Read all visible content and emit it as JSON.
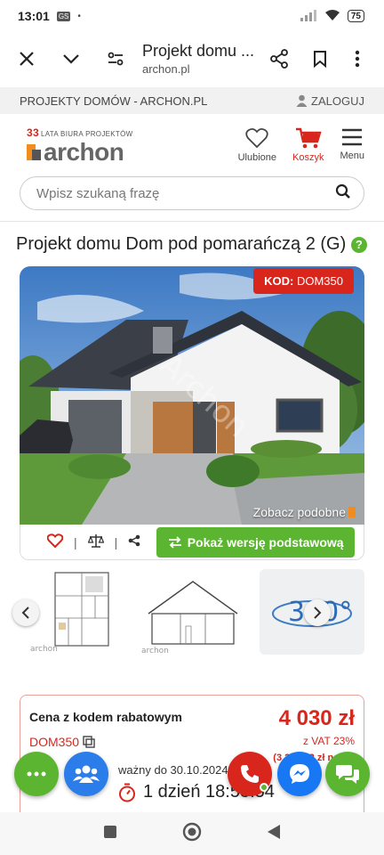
{
  "status_bar": {
    "time": "13:01",
    "gs_badge": "GS",
    "dot": "•",
    "battery": "75"
  },
  "browser": {
    "title": "Projekt domu ...",
    "url": "archon.pl"
  },
  "top_strip": {
    "left": "PROJEKTY DOMÓW - ARCHON.PL",
    "login": "ZALOGUJ"
  },
  "logo": {
    "years": "33",
    "years_text": "LATA BIURA PROJEKTÓW",
    "word": "archon"
  },
  "header_icons": {
    "favorites": "Ulubione",
    "cart": "Koszyk",
    "menu": "Menu"
  },
  "search": {
    "placeholder": "Wpisz szukaną frazę"
  },
  "project": {
    "title": "Projekt domu Dom pod pomarańczą 2 (G)",
    "help": "?"
  },
  "hero": {
    "kod_label": "KOD:",
    "kod_value": "DOM350",
    "watermark": "Archon",
    "similar": "Zobacz podobne"
  },
  "actions": {
    "separator": "|",
    "basic_button": "Pokaż wersję podstawową"
  },
  "thumbnails": {
    "label_360": "360°",
    "plan_logo": "archon",
    "section_logo": "archon"
  },
  "price": {
    "label": "Cena z kodem rabatowym",
    "value": "4 030 zł",
    "code": "DOM350",
    "vat": "z VAT 23%",
    "netto": "(3 276,42 zł netto)",
    "valid_until": "ważny do 30.10.2024",
    "countdown": "1 dzień 18:58:54"
  },
  "colors": {
    "accent_red": "#d8261d",
    "accent_green": "#5bb530",
    "brand_orange": "#f28c1e",
    "messenger_blue": "#1877f2",
    "people_blue": "#2b7de9"
  }
}
